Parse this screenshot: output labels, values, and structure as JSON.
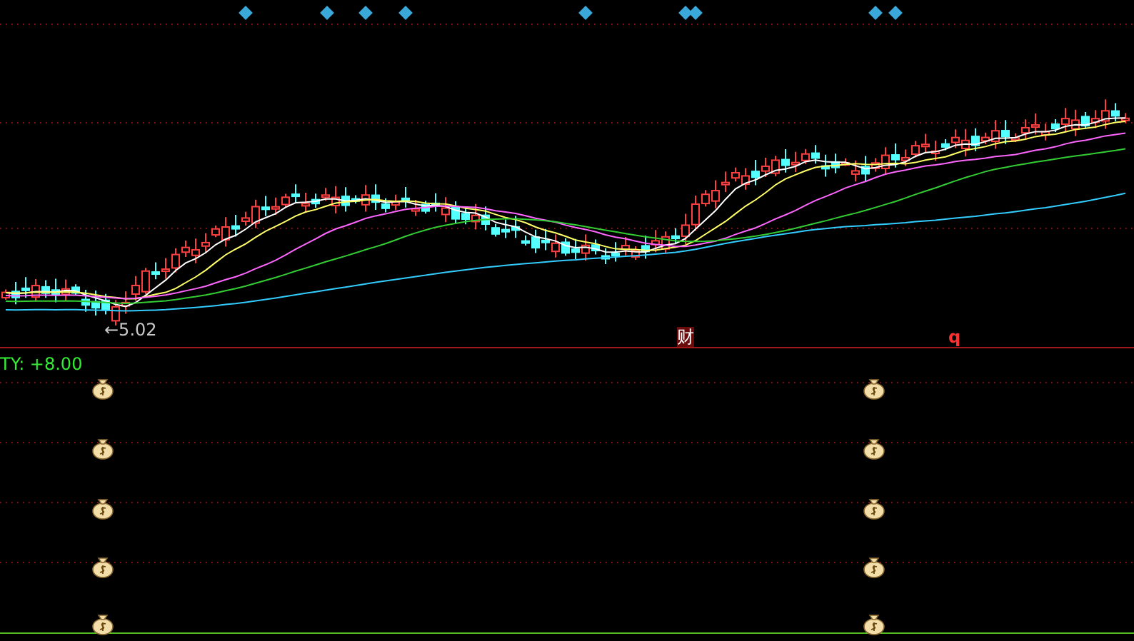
{
  "price_panel": {
    "low_annotation": "←5.02",
    "event_marks": [
      {
        "text": "财",
        "kind": "finance"
      },
      {
        "text": "q",
        "kind": "letter"
      }
    ]
  },
  "indicator_panel": {
    "label": "TY: +8.00"
  }
}
